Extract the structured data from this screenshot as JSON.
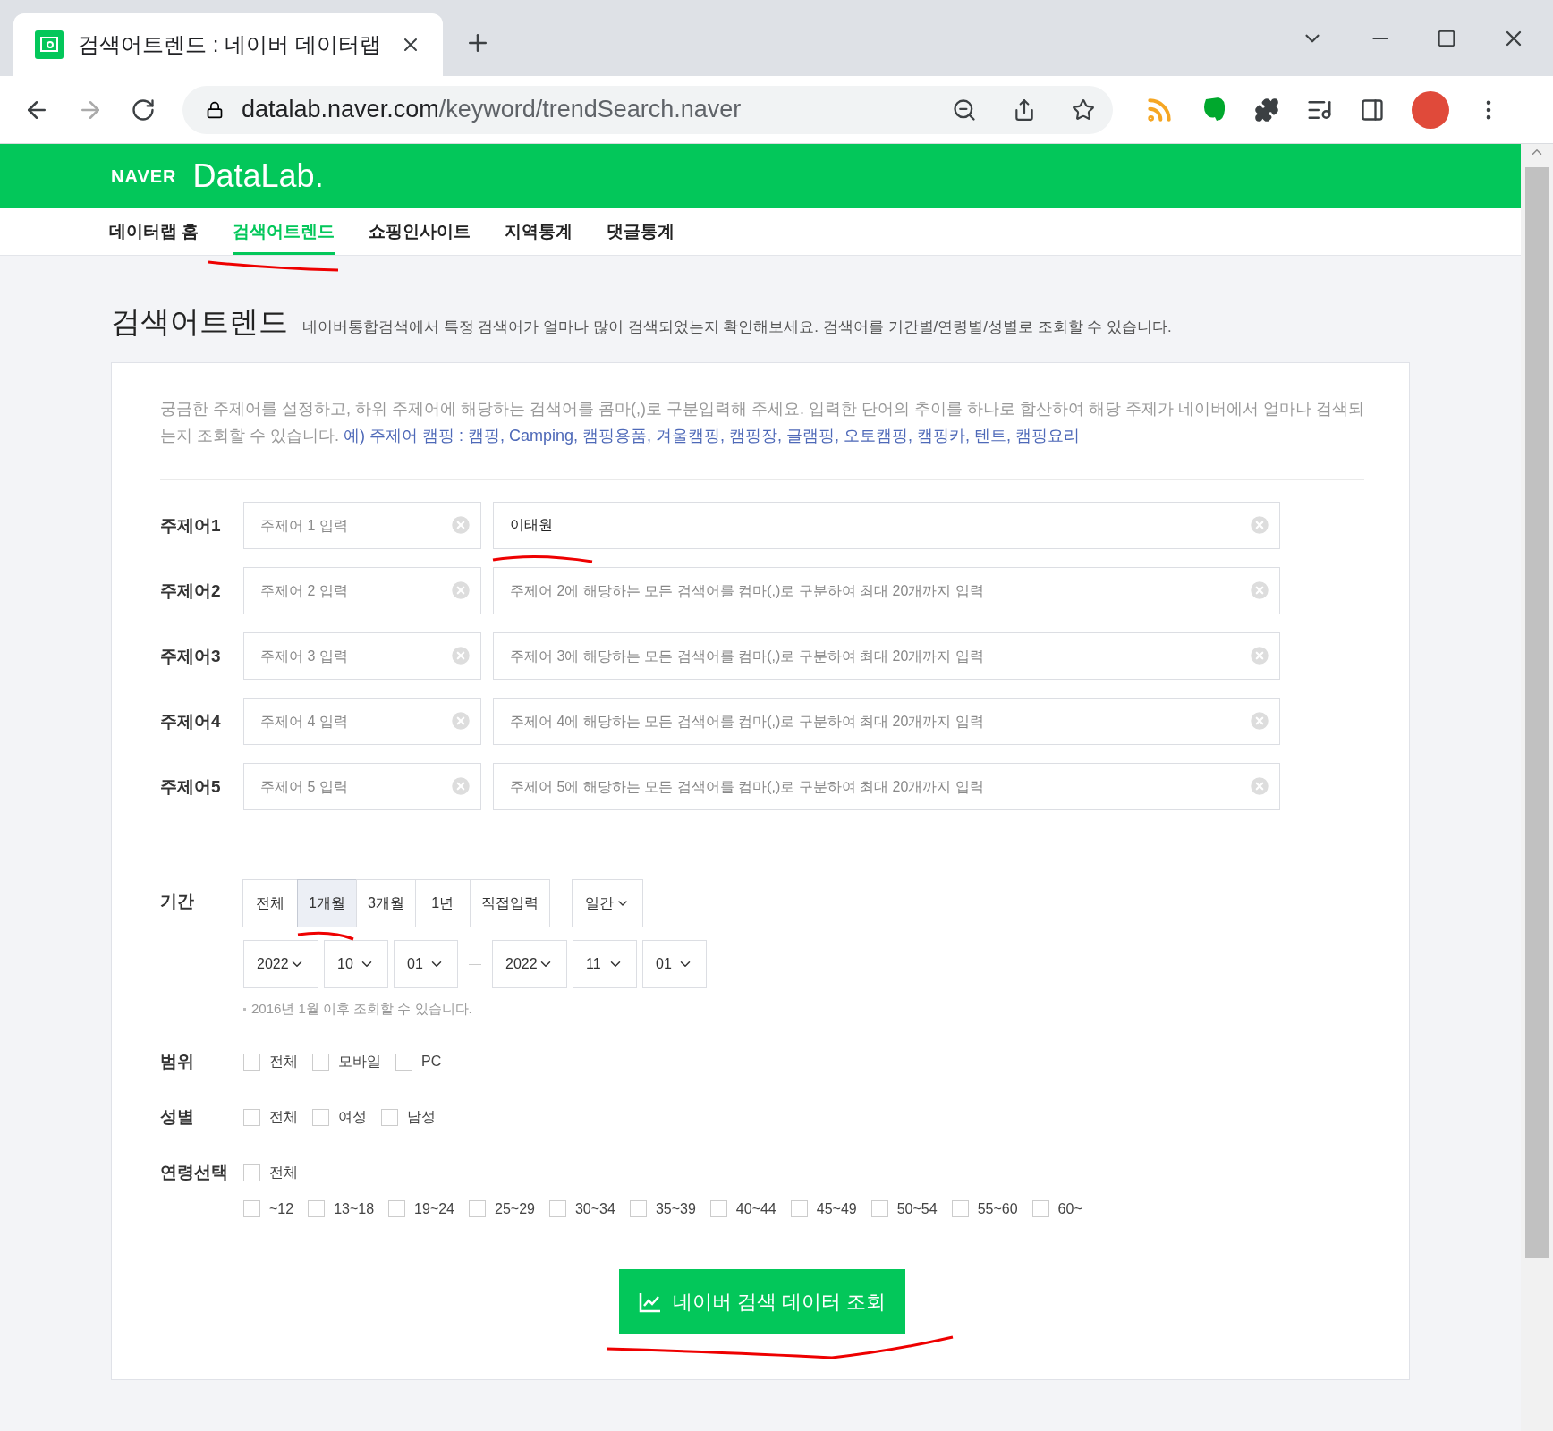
{
  "browser": {
    "tab_title": "검색어트렌드 : 네이버 데이터랩",
    "url_host": "datalab.naver.com",
    "url_path": "/keyword/trendSearch.naver"
  },
  "header": {
    "brand": "NAVER",
    "product": "DataLab."
  },
  "nav": [
    {
      "label": "데이터랩 홈",
      "selected": false
    },
    {
      "label": "검색어트렌드",
      "selected": true
    },
    {
      "label": "쇼핑인사이트",
      "selected": false
    },
    {
      "label": "지역통계",
      "selected": false
    },
    {
      "label": "댓글통계",
      "selected": false
    }
  ],
  "page": {
    "title": "검색어트렌드",
    "subtitle": "네이버통합검색에서 특정 검색어가 얼마나 많이 검색되었는지 확인해보세요. 검색어를 기간별/연령별/성별로 조회할 수 있습니다."
  },
  "intro": {
    "text": "궁금한 주제어를 설정하고, 하위 주제어에 해당하는 검색어를 콤마(,)로 구분입력해 주세요. 입력한 단어의 추이를 하나로 합산하여 해당 주제가 네이버에서 얼마나 검색되는지 조회할 수 있습니다.",
    "example": "예) 주제어 캠핑 : 캠핑, Camping, 캠핑용품, 겨울캠핑, 캠핑장, 글램핑, 오토캠핑, 캠핑카, 텐트, 캠핑요리"
  },
  "topics": [
    {
      "label": "주제어1",
      "name_placeholder": "주제어 1 입력",
      "keywords_value": "이태원"
    },
    {
      "label": "주제어2",
      "name_placeholder": "주제어 2 입력",
      "keywords_placeholder": "주제어 2에 해당하는 모든 검색어를 컴마(,)로 구분하여 최대 20개까지 입력"
    },
    {
      "label": "주제어3",
      "name_placeholder": "주제어 3 입력",
      "keywords_placeholder": "주제어 3에 해당하는 모든 검색어를 컴마(,)로 구분하여 최대 20개까지 입력"
    },
    {
      "label": "주제어4",
      "name_placeholder": "주제어 4 입력",
      "keywords_placeholder": "주제어 4에 해당하는 모든 검색어를 컴마(,)로 구분하여 최대 20개까지 입력"
    },
    {
      "label": "주제어5",
      "name_placeholder": "주제어 5 입력",
      "keywords_placeholder": "주제어 5에 해당하는 모든 검색어를 컴마(,)로 구분하여 최대 20개까지 입력"
    }
  ],
  "period": {
    "label": "기간",
    "presets": [
      {
        "label": "전체",
        "selected": false
      },
      {
        "label": "1개월",
        "selected": true
      },
      {
        "label": "3개월",
        "selected": false
      },
      {
        "label": "1년",
        "selected": false
      },
      {
        "label": "직접입력",
        "selected": false
      }
    ],
    "interval": "일간",
    "start": [
      "2022",
      "10",
      "01"
    ],
    "end": [
      "2022",
      "11",
      "01"
    ],
    "note": "2016년 1월 이후 조회할 수 있습니다."
  },
  "scope": {
    "label": "범위",
    "options": [
      {
        "label": "전체",
        "checked": false
      },
      {
        "label": "모바일",
        "checked": false
      },
      {
        "label": "PC",
        "checked": false
      }
    ]
  },
  "gender": {
    "label": "성별",
    "options": [
      {
        "label": "전체",
        "checked": false
      },
      {
        "label": "여성",
        "checked": false
      },
      {
        "label": "남성",
        "checked": false
      }
    ]
  },
  "age": {
    "label": "연령선택",
    "all": {
      "label": "전체",
      "checked": false
    },
    "ranges": [
      {
        "label": "~12",
        "checked": false
      },
      {
        "label": "13~18",
        "checked": false
      },
      {
        "label": "19~24",
        "checked": false
      },
      {
        "label": "25~29",
        "checked": false
      },
      {
        "label": "30~34",
        "checked": false
      },
      {
        "label": "35~39",
        "checked": false
      },
      {
        "label": "40~44",
        "checked": false
      },
      {
        "label": "45~49",
        "checked": false
      },
      {
        "label": "50~54",
        "checked": false
      },
      {
        "label": "55~60",
        "checked": false
      },
      {
        "label": "60~",
        "checked": false
      }
    ]
  },
  "submit": "네이버 검색 데이터 조회"
}
